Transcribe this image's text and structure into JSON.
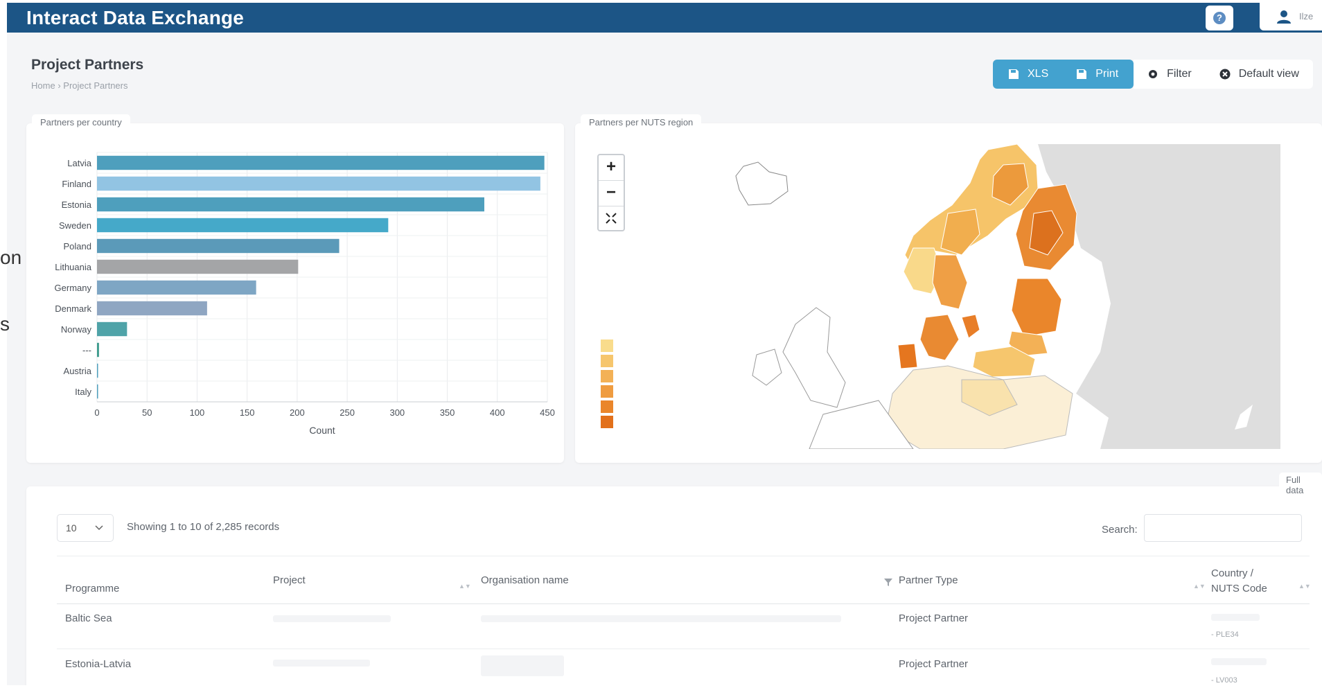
{
  "header": {
    "app_title": "Interact Data Exchange",
    "help_label": "?",
    "user_name": "Ilze"
  },
  "page": {
    "title": "Project Partners",
    "breadcrumb": [
      "Home",
      "Project Partners"
    ]
  },
  "toolbar": {
    "xls_label": "XLS",
    "print_label": "Print",
    "filter_label": "Filter",
    "default_view_label": "Default view"
  },
  "side_fragments": [
    "on",
    "s"
  ],
  "bar_panel": {
    "label": "Partners per country"
  },
  "map_panel": {
    "label": "Partners per NUTS region",
    "zoom_in": "+",
    "zoom_out": "−",
    "legend_colors": [
      "#f9dc8c",
      "#f6c66d",
      "#f3b156",
      "#ef9c40",
      "#ea862b",
      "#e2701b"
    ]
  },
  "chart_data": {
    "type": "bar",
    "orientation": "horizontal",
    "categories": [
      "Latvia",
      "Finland",
      "Estonia",
      "Sweden",
      "Poland",
      "Lithuania",
      "Germany",
      "Denmark",
      "Norway",
      "---",
      "Austria",
      "Italy"
    ],
    "values": [
      447,
      443,
      387,
      291,
      242,
      201,
      159,
      110,
      30,
      2,
      1,
      1
    ],
    "colors": [
      "#4e9fbd",
      "#92c4e3",
      "#4e9fbd",
      "#45a9c9",
      "#5b9ab9",
      "#a4a5a7",
      "#7ea6c4",
      "#8fa6c2",
      "#4fa3a8",
      "#3f9c8e",
      "#4e9fbd",
      "#4e9fbd"
    ],
    "xlabel": "Count",
    "ylabel": "",
    "xlim": [
      0,
      450
    ],
    "xticks": [
      0,
      50,
      100,
      150,
      200,
      250,
      300,
      350,
      400,
      450
    ],
    "grid": true
  },
  "table": {
    "full_data_label": "Full data",
    "page_size": "10",
    "records_text": "Showing 1 to 10 of 2,285 records",
    "search_label": "Search:",
    "search_value": "",
    "columns": [
      "Programme",
      "Project",
      "Organisation name",
      "Partner Type",
      "Country /",
      "NUTS Code"
    ],
    "rows": [
      {
        "programme": "Baltic Sea",
        "partner_type": "Project Partner",
        "nuts_code": "- PLE34"
      },
      {
        "programme": "Estonia-Latvia",
        "partner_type": "Project Partner",
        "nuts_code": "- LV003"
      }
    ]
  }
}
